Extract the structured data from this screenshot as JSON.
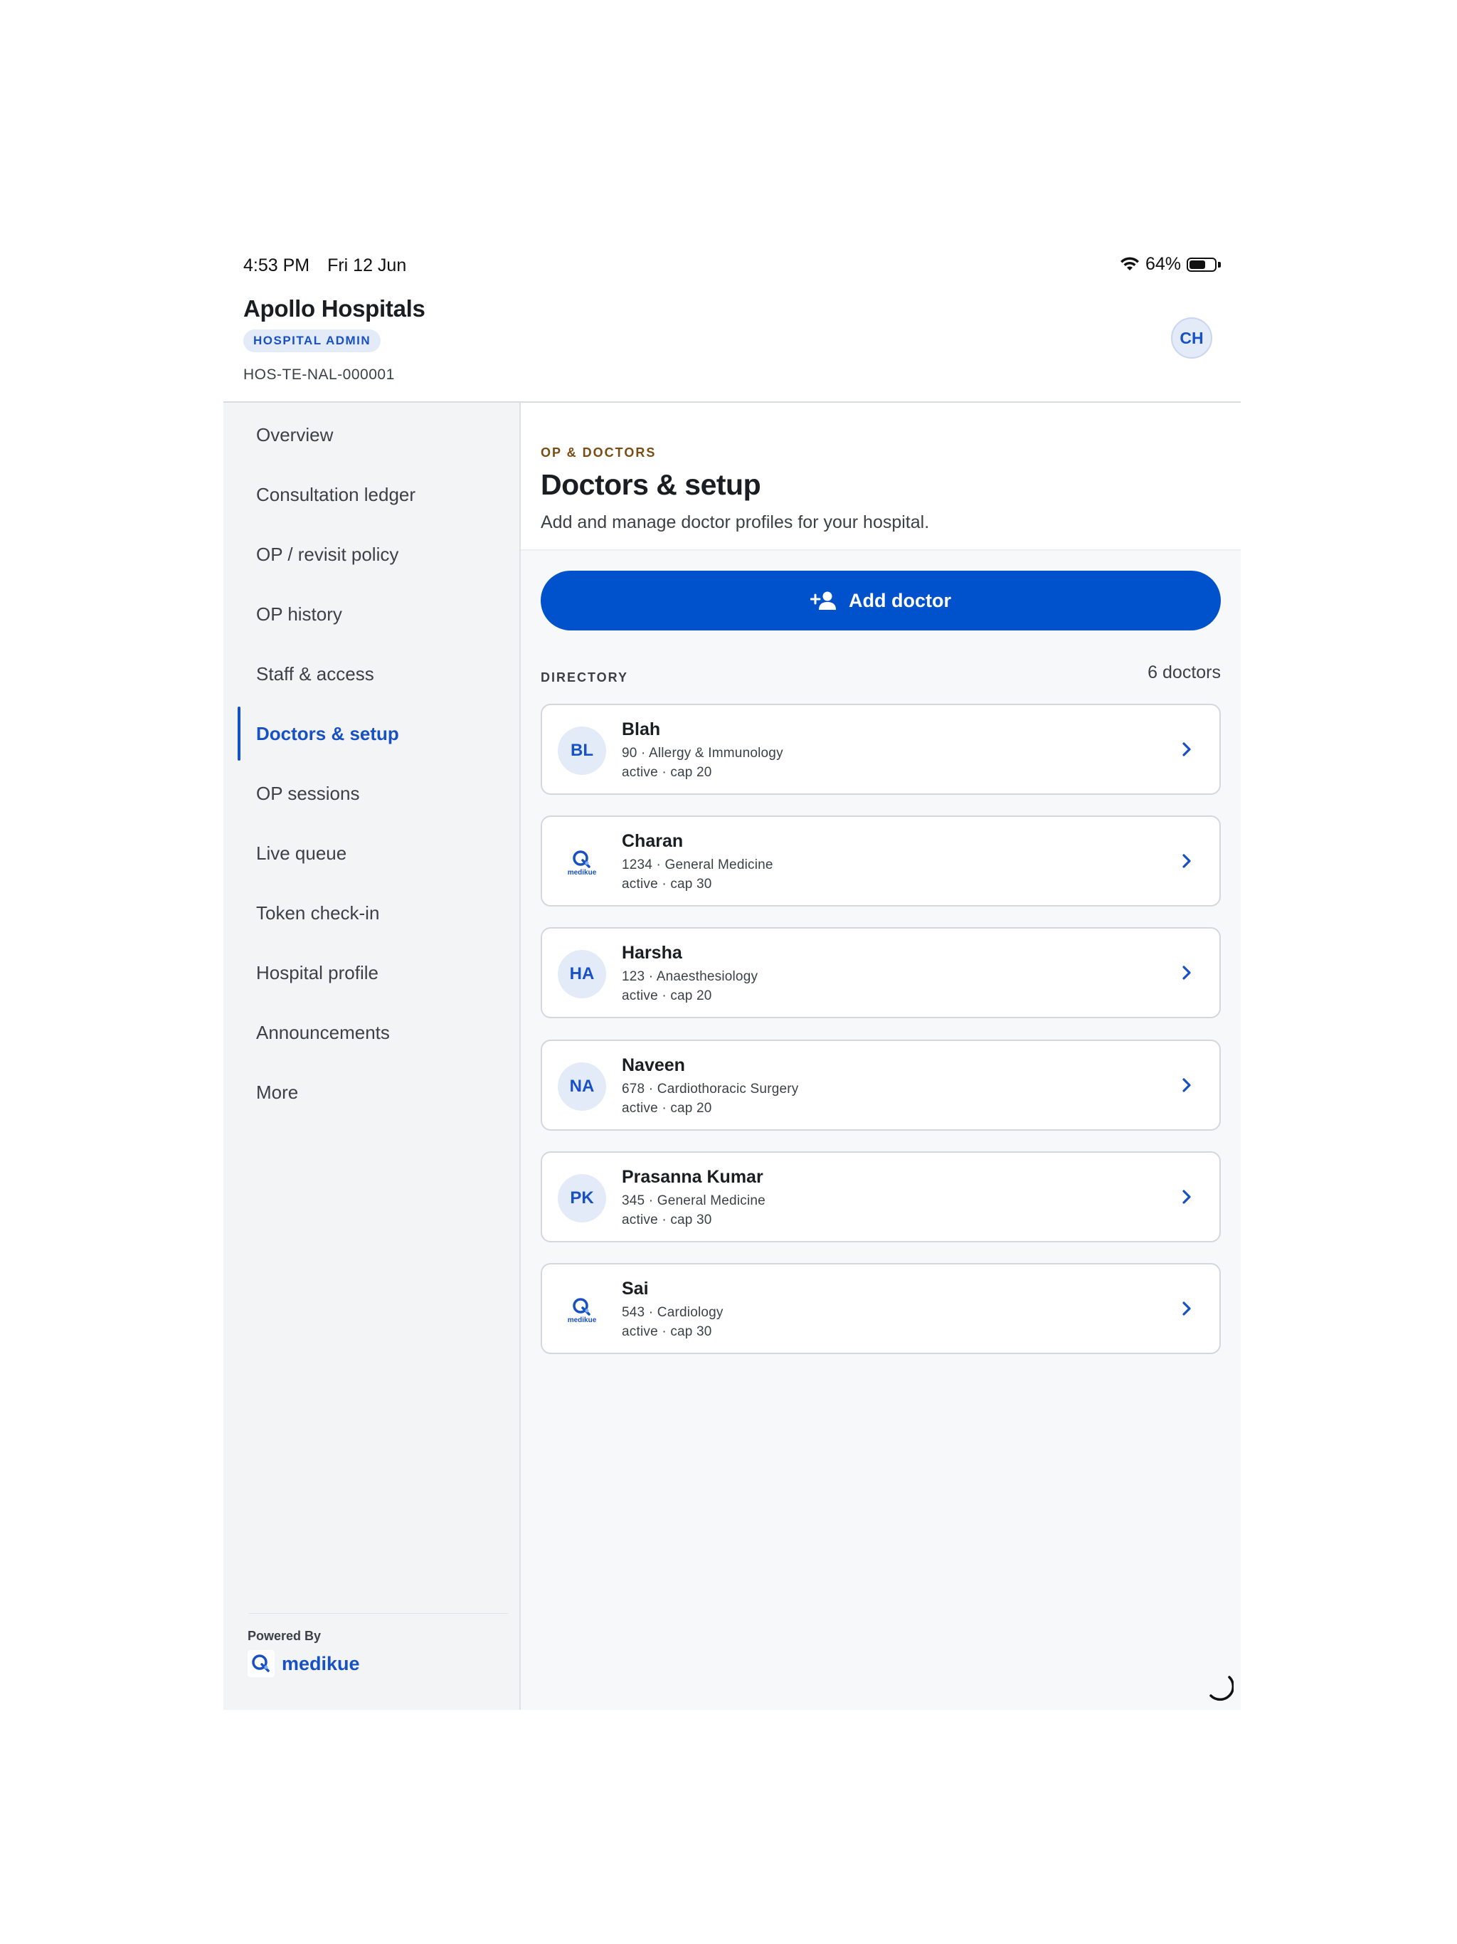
{
  "status_bar": {
    "time": "4:53 PM",
    "date": "Fri 12 Jun",
    "battery": "64%",
    "battery_level": 0.64
  },
  "header": {
    "hospital_name": "Apollo Hospitals",
    "role_badge": "HOSPITAL ADMIN",
    "hospital_code": "HOS-TE-NAL-000001",
    "user_initials": "CH"
  },
  "sidebar": {
    "items": [
      {
        "label": "Overview"
      },
      {
        "label": "Consultation ledger"
      },
      {
        "label": "OP / revisit policy"
      },
      {
        "label": "OP history"
      },
      {
        "label": "Staff & access"
      },
      {
        "label": "Doctors & setup",
        "active": true
      },
      {
        "label": "OP sessions"
      },
      {
        "label": "Live queue"
      },
      {
        "label": "Token check-in"
      },
      {
        "label": "Hospital profile"
      },
      {
        "label": "Announcements"
      },
      {
        "label": "More"
      }
    ],
    "powered_by": "Powered By",
    "brand": "medikue"
  },
  "main": {
    "eyebrow": "OP & DOCTORS",
    "title": "Doctors & setup",
    "subtitle": "Add and manage doctor profiles for your hospital.",
    "add_button": "Add doctor",
    "directory_label": "DIRECTORY",
    "directory_count": "6 doctors",
    "doctors": [
      {
        "name": "Blah",
        "meta": "90 · Allergy & Immunology",
        "status": "active · cap 20",
        "initials": "BL"
      },
      {
        "name": "Charan",
        "meta": "1234 · General Medicine",
        "status": "active · cap 30",
        "logo_caption": "medikue"
      },
      {
        "name": "Harsha",
        "meta": "123 · Anaesthesiology",
        "status": "active · cap 20",
        "initials": "HA"
      },
      {
        "name": "Naveen",
        "meta": "678 · Cardiothoracic Surgery",
        "status": "active · cap 20",
        "initials": "NA"
      },
      {
        "name": "Prasanna Kumar",
        "meta": "345 · General Medicine",
        "status": "active · cap 30",
        "initials": "PK"
      },
      {
        "name": "Sai",
        "meta": "543 · Cardiology",
        "status": "active · cap 30",
        "logo_caption": "medikue"
      }
    ]
  },
  "colors": {
    "accent": "#0052cc",
    "accent_text": "#1851c4",
    "avatar_bg": "#e3ebf8",
    "eyebrow": "#7a4b12"
  }
}
